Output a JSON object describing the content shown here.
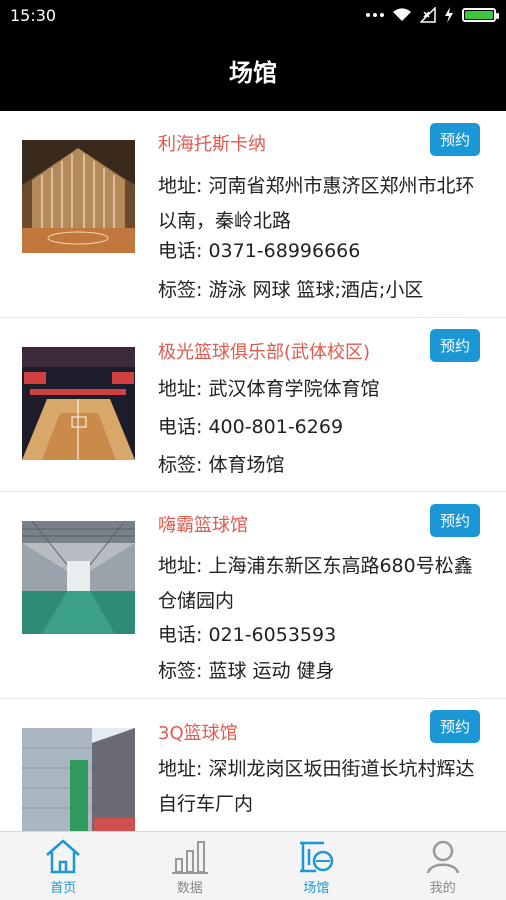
{
  "status_bar": {
    "time": "15:30"
  },
  "header": {
    "title": "场馆"
  },
  "venues": [
    {
      "name": "利海托斯卡纳",
      "book_label": "预约",
      "address": "地址: 河南省郑州市惠济区郑州市北环以南，秦岭北路",
      "phone": "电话: 0371-68996666",
      "tags": "标签: 游泳 网球 篮球;酒店;小区"
    },
    {
      "name": "极光篮球俱乐部(武体校区)",
      "book_label": "预约",
      "address": "地址: 武汉体育学院体育馆",
      "phone": "电话: 400-801-6269",
      "tags": "标签: 体育场馆"
    },
    {
      "name": "嗨霸篮球馆",
      "book_label": "预约",
      "address": "地址: 上海浦东新区东高路680号松鑫仓储园内",
      "phone": "电话: 021-6053593",
      "tags": "标签: 蓝球 运动 健身"
    },
    {
      "name": "3Q篮球馆",
      "book_label": "预约",
      "address": "地址: 深圳龙岗区坂田街道长坑村辉达自行车厂内",
      "phone": "",
      "tags": ""
    }
  ],
  "tabs": [
    {
      "label": "首页",
      "icon": "home-icon",
      "active": true
    },
    {
      "label": "数据",
      "icon": "chart-icon",
      "active": false
    },
    {
      "label": "场馆",
      "icon": "venue-icon",
      "active": true
    },
    {
      "label": "我的",
      "icon": "person-icon",
      "active": false
    }
  ],
  "colors": {
    "accent": "#1b97d6",
    "venue_name": "#e05a4f",
    "header_bg": "#000000"
  }
}
